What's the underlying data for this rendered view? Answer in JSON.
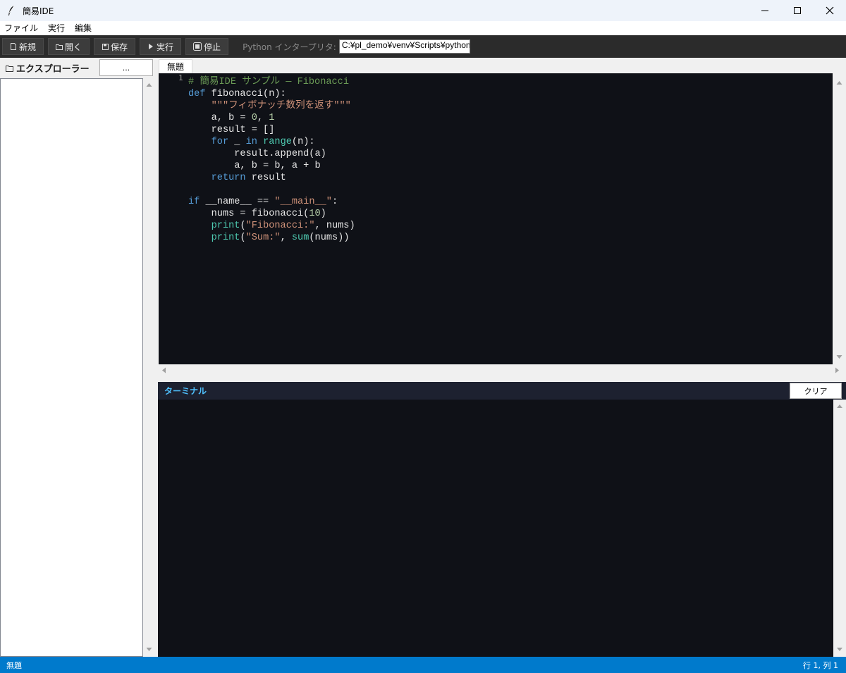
{
  "window": {
    "title": "簡易IDE"
  },
  "menu": {
    "items": [
      "ファイル",
      "実行",
      "編集"
    ]
  },
  "toolbar": {
    "new_label": "新規",
    "open_label": "開く",
    "save_label": "保存",
    "run_label": "実行",
    "stop_label": "停止",
    "interpreter_label": "Python インタープリタ:",
    "interpreter_path": "C:¥pl_demo¥venv¥Scripts¥python."
  },
  "explorer": {
    "title": "エクスプローラー",
    "browse_label": "..."
  },
  "editor": {
    "tab_label": "無題",
    "line_number": "1",
    "code_lines": [
      "# 簡易IDE サンプル — Fibonacci",
      "def fibonacci(n):",
      "    \"\"\"フィボナッチ数列を返す\"\"\"",
      "    a, b = 0, 1",
      "    result = []",
      "    for _ in range(n):",
      "        result.append(a)",
      "        a, b = b, a + b",
      "    return result",
      "",
      "if __name__ == \"__main__\":",
      "    nums = fibonacci(10)",
      "    print(\"Fibonacci:\", nums)",
      "    print(\"Sum:\", sum(nums))"
    ]
  },
  "terminal": {
    "title": "ターミナル",
    "clear_label": "クリア"
  },
  "status": {
    "file": "無題",
    "cursor": "行 1, 列 1"
  },
  "colors": {
    "statusbar": "#007acc",
    "toolbar": "#2b2b2b",
    "editor_bg": "#0f1117",
    "keyword": "#569cd6",
    "string": "#ce9178",
    "comment": "#6a9955",
    "builtin": "#4ec9b0",
    "terminal_title": "#4fc1ff"
  }
}
